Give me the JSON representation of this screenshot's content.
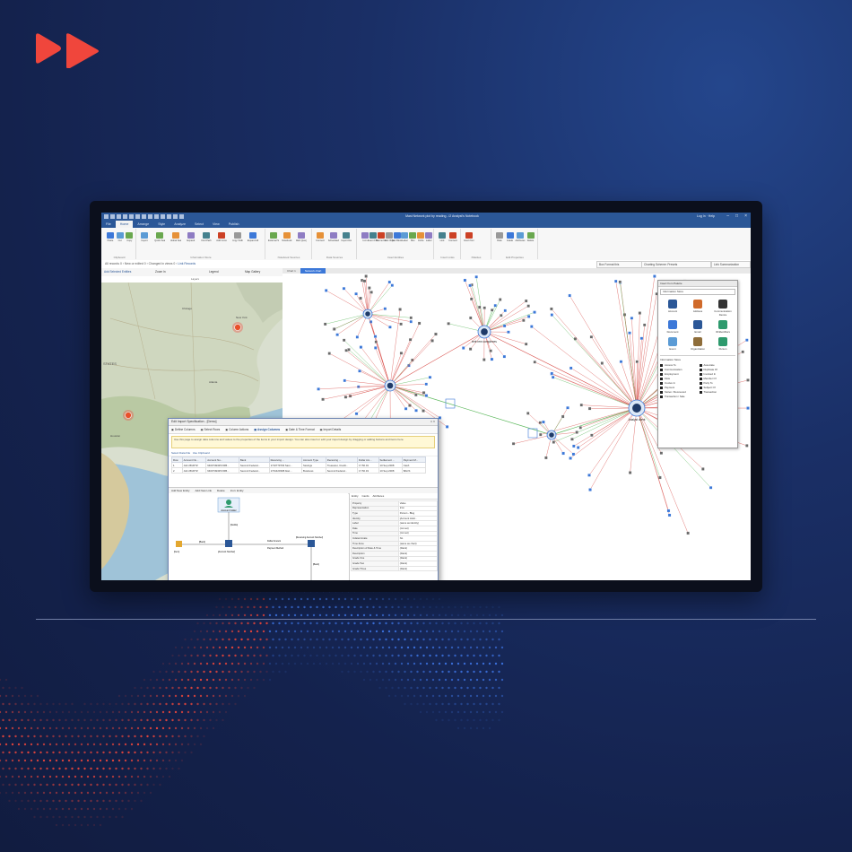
{
  "app": {
    "title": "Mast Network plot by reading - i2 Analyst's Notebook",
    "user": "Log In",
    "help": "Help",
    "menus": [
      "File",
      "Home",
      "Arrange",
      "Style",
      "Analyze",
      "Select",
      "View",
      "Publish"
    ],
    "active_menu": "Home"
  },
  "ribbon": {
    "groups": [
      {
        "label": "Clipboard",
        "buttons": [
          "Paste",
          "Cut",
          "Copy"
        ]
      },
      {
        "label": "Information Store",
        "buttons": [
          "Import",
          "Quick Search",
          "Global Search",
          "Expand",
          "Find Path",
          "Add Connected",
          "Copy Visible",
          "Expand All"
        ]
      },
      {
        "label": "Notebook Sources",
        "buttons": [
          "External Searches",
          "Notebook Import",
          "Web Query"
        ]
      },
      {
        "label": "Data Sources",
        "buttons": [
          "Connect",
          "Scheduled Imports",
          "Import Data"
        ]
      },
      {
        "label": "Insert Entities",
        "buttons": [
          "Icon",
          "Event Frame",
          "Theme Line",
          "OLE Object",
          "Text Block",
          "Label",
          "Box",
          "Circle",
          "Label"
        ]
      },
      {
        "label": "Insert Links",
        "buttons": [
          "Link",
          "Connect"
        ]
      },
      {
        "label": "Palettes",
        "buttons": [
          "Insert from Palette"
        ]
      },
      {
        "label": "Edit Properties",
        "buttons": [
          "Date",
          "Grade",
          "Attributes",
          "Delete"
        ]
      }
    ]
  },
  "cmdbar": {
    "breadcrumb": [
      "All records 0",
      "New or edited 0",
      "Changed in views 0",
      "Link Records"
    ],
    "right_controls": [
      "Box Format this",
      "Charting Scheme: Presets",
      "Link Summarization"
    ]
  },
  "map_panel": {
    "toolbar": [
      "Add Selected Entities",
      "Zoom In",
      "Zoom Out",
      "Legend",
      "Layers",
      "Map Gallery"
    ],
    "labels": [
      "STATES",
      "Boston",
      "Houston",
      "New York",
      "Chicago",
      "Atlanta"
    ]
  },
  "graph": {
    "tabs": [
      "Chart 1",
      "Network chart"
    ],
    "active_tab": "Network chart",
    "hub_labels": [
      "Analyst client",
      "tent rem complexes"
    ]
  },
  "palette": {
    "title": "Insert from Palette",
    "selected": "Information Store",
    "entities": [
      "Account",
      "Address",
      "Communication Device",
      "Document",
      "Email",
      "ID/Identifiers",
      "Event",
      "Organization",
      "Person"
    ],
    "links_title": "Information Store",
    "links": [
      "Access To",
      "Associate",
      "Communication",
      "Duplicate Of",
      "Employment",
      "Involved In",
      "Flow",
      "Member Of",
      "Involve In",
      "Party To",
      "Payment",
      "Subject Of",
      "Stolen / Recovered",
      "Transaction",
      "Transaction / Sale"
    ]
  },
  "dialog": {
    "title": "Edit Import Specification - [Demo]",
    "steps": [
      "Define Columns",
      "Select Rows",
      "Column Actions",
      "Assign Columns",
      "Date & Time Format",
      "Import Details"
    ],
    "active_step": "Assign Columns",
    "hint": "Use this page to assign data columns and values to the properties of the items in your import design. You can also insert or edit your import design by dragging or adding buttons and items here.",
    "data_tools": [
      "Select Data File",
      "Use Clipboard"
    ],
    "table": {
      "headers": [
        "Row",
        "Account Nu...",
        "Account Nu...",
        "Bank",
        "Receiving ...",
        "Account Type",
        "Receiving ...",
        "Dollar Am...",
        "Settlement ...",
        "Payment M..."
      ],
      "rows": [
        [
          "1",
          "John BURTZ",
          "6403749325 FRB...",
          "Second Federal...",
          "1710779703 Savi...",
          "Savings",
          "Treasurer, Credit...",
          "17.50.01",
          "10 Sep 2008",
          "Cash"
        ],
        [
          "2",
          "John BURTZ",
          "6403749325 FRB...",
          "Second Federal...",
          "1701420308 Alac...",
          "Business",
          "Second Federal...",
          "17.50.19",
          "10 Sep 2008",
          "BACS"
        ]
      ]
    },
    "design_toolbar": [
      "Add New Entity",
      "Add New Link",
      "Delete",
      "Icon: Entity"
    ],
    "design_labels": [
      "Account holder",
      "[Item]",
      "[Debits]",
      "[Account Number]",
      "[Receiving Account Number]",
      "[Bank]",
      "[Bank]",
      "Dollar Amount",
      "Payment Method"
    ],
    "props_tabs": [
      "Entity",
      "Cards",
      "Attributes"
    ],
    "props": [
      [
        "Property",
        "Value"
      ],
      [
        "Representation",
        "Icon"
      ],
      [
        "Type",
        "Person - Blog"
      ],
      [
        "Identity",
        "[Account Hold..."
      ],
      [
        "Label",
        "(same as identity)"
      ],
      [
        "Date",
        "(not set)"
      ],
      [
        "Time",
        "(not set)"
      ],
      [
        "Indeterminate",
        "No"
      ],
      [
        "Time Zone",
        "(same as chart)"
      ],
      [
        "Description of Date & Time",
        "(blank)"
      ],
      [
        "Description",
        "(blank)"
      ],
      [
        "Grade One",
        "(blank)"
      ],
      [
        "Grade Two",
        "(blank)"
      ],
      [
        "Grade Three",
        "(blank)"
      ]
    ]
  },
  "colors": {
    "background": "#14224d",
    "brand_red": "#f0463c",
    "link_red": "#d9534f",
    "link_green": "#5cb85c",
    "ribbon_blue": "#2b5797"
  }
}
